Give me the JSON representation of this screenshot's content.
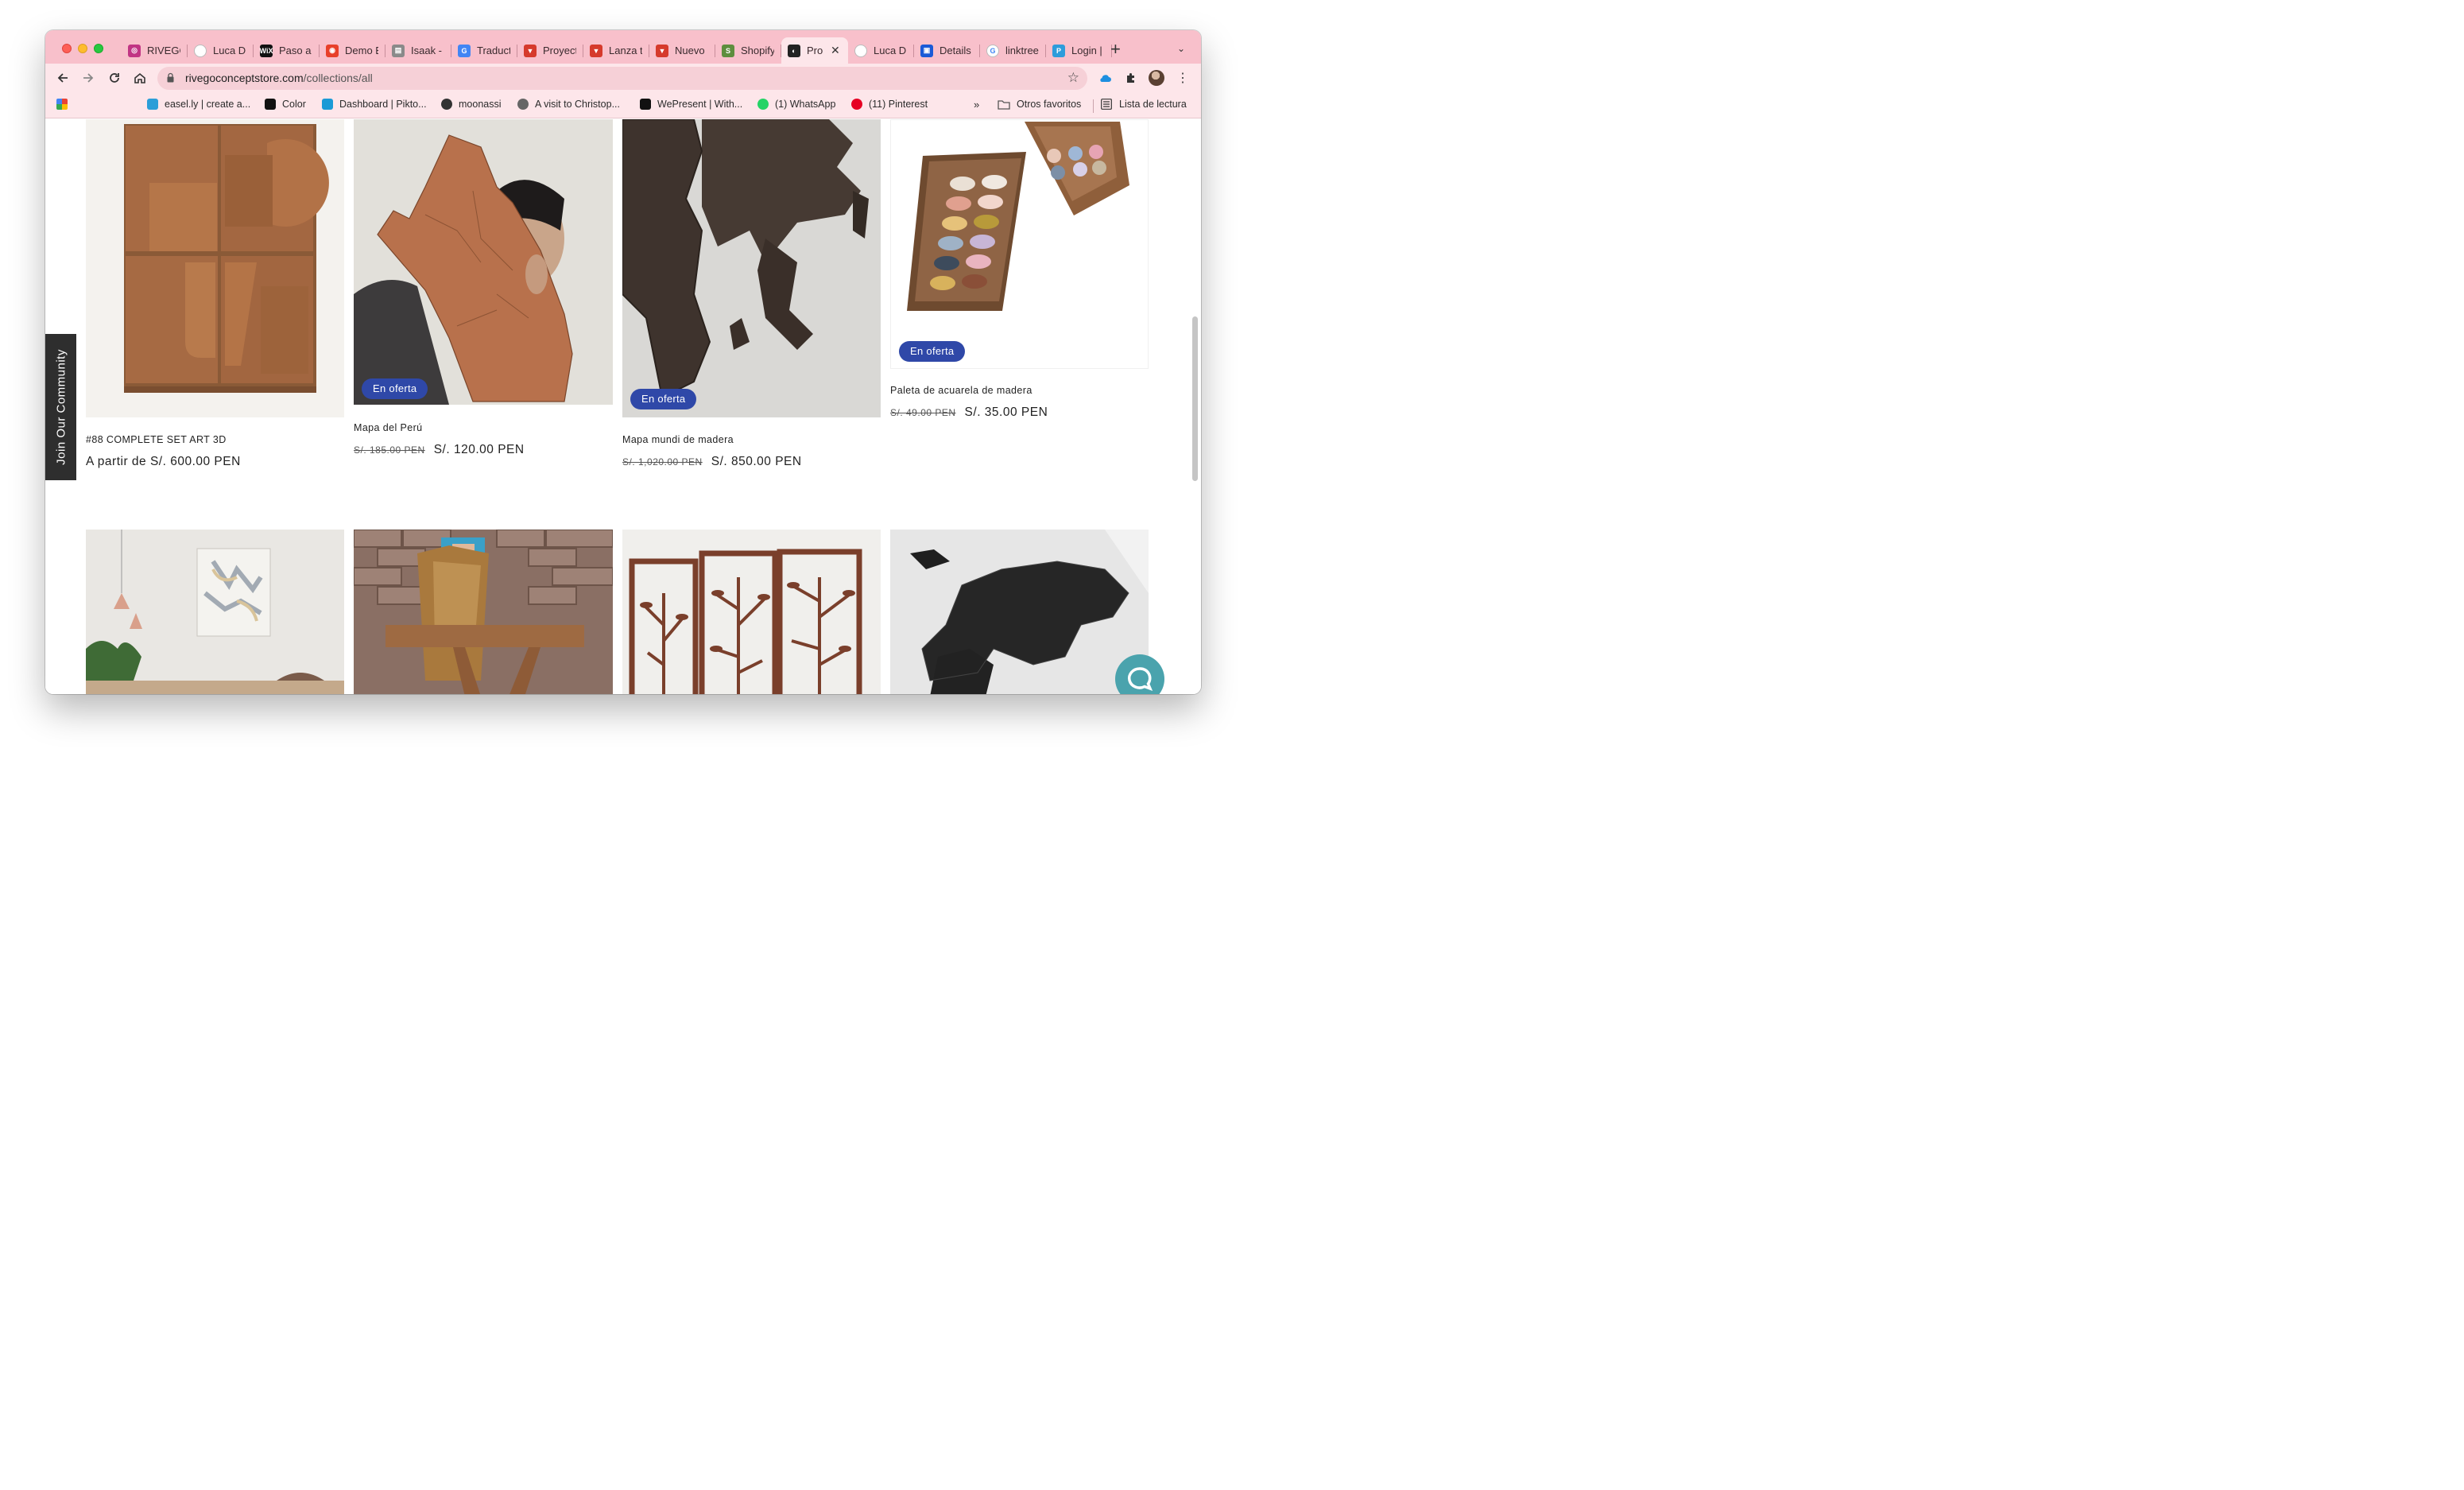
{
  "browser": {
    "tabs": [
      {
        "label": "RIVEGO",
        "icon": "instagram-icon",
        "color": "#c13584",
        "glyph": "◎"
      },
      {
        "label": "Luca D",
        "icon": "site-icon",
        "color": "#ffffff",
        "glyph": ""
      },
      {
        "label": "Paso a",
        "icon": "wix-icon",
        "color": "#111111",
        "glyph": "WiX"
      },
      {
        "label": "Demo E",
        "icon": "pitch-icon",
        "color": "#e8402a",
        "glyph": "◉"
      },
      {
        "label": "Isaak -",
        "icon": "document-icon",
        "color": "#8a8a8a",
        "glyph": "▤"
      },
      {
        "label": "Traduct",
        "icon": "translate-icon",
        "color": "#4285f4",
        "glyph": "G"
      },
      {
        "label": "Proyect",
        "icon": "red-app-icon",
        "color": "#d63a2c",
        "glyph": "▼"
      },
      {
        "label": "Lanza t",
        "icon": "red-app-icon",
        "color": "#d63a2c",
        "glyph": "▼"
      },
      {
        "label": "Nuevo",
        "icon": "red-app-icon",
        "color": "#d63a2c",
        "glyph": "▼"
      },
      {
        "label": "Shopify",
        "icon": "shopify-icon",
        "color": "#5e8e3e",
        "glyph": "S"
      },
      {
        "label": "Pro",
        "icon": "globe-icon",
        "color": "#222222",
        "glyph": "◐",
        "active": true
      },
      {
        "label": "Luca D",
        "icon": "site-icon",
        "color": "#ffffff",
        "glyph": ""
      },
      {
        "label": "Details",
        "icon": "details-icon",
        "color": "#1a5ad7",
        "glyph": "▣"
      },
      {
        "label": "linktree",
        "icon": "google-icon",
        "color": "#ffffff",
        "glyph": "G"
      },
      {
        "label": "Login |",
        "icon": "login-icon",
        "color": "#2d9cdb",
        "glyph": "P"
      }
    ],
    "url_host": "rivegoconceptstore.com",
    "url_path": "/collections/all",
    "bookmarks": [
      {
        "label": "",
        "icon": "apps-grid-icon"
      },
      {
        "label": "easel.ly | create a...",
        "icon": "easelly-icon"
      },
      {
        "label": "Color",
        "icon": "color-icon"
      },
      {
        "label": "Dashboard | Pikto...",
        "icon": "piktochart-icon"
      },
      {
        "label": "moonassi",
        "icon": "avatar-icon"
      },
      {
        "label": "A visit to Christop...",
        "icon": "globe-icon"
      },
      {
        "label": "WePresent | With...",
        "icon": "wepresent-icon"
      },
      {
        "label": "(1) WhatsApp",
        "icon": "whatsapp-icon"
      },
      {
        "label": "(11) Pinterest",
        "icon": "pinterest-icon"
      }
    ],
    "overflow_label": "»",
    "other_bookmarks": "Otros favoritos",
    "reading_list": "Lista de lectura"
  },
  "store": {
    "community_label": "Join Our Community",
    "sale_badge": "En oferta",
    "products": [
      {
        "title": "#88 COMPLETE SET ART 3D",
        "price_prefix": "A partir de S/. 600.00 PEN",
        "old_price": "",
        "price": "",
        "on_sale": false
      },
      {
        "title": "Mapa del Perú",
        "old_price": "S/. 185.00 PEN",
        "price": "S/. 120.00 PEN",
        "on_sale": true
      },
      {
        "title": "Mapa mundi de madera",
        "old_price": "S/. 1,020.00 PEN",
        "price": "S/. 850.00 PEN",
        "on_sale": true
      },
      {
        "title": "Paleta de acuarela de madera",
        "old_price": "S/. 49.00 PEN",
        "price": "S/. 35.00 PEN",
        "on_sale": true
      }
    ]
  },
  "colors": {
    "tabstrip": "#f8c0cb",
    "toolbar": "#fde6ea",
    "sale_badge": "#2f48a8",
    "chat_button": "#4aa3ad"
  }
}
